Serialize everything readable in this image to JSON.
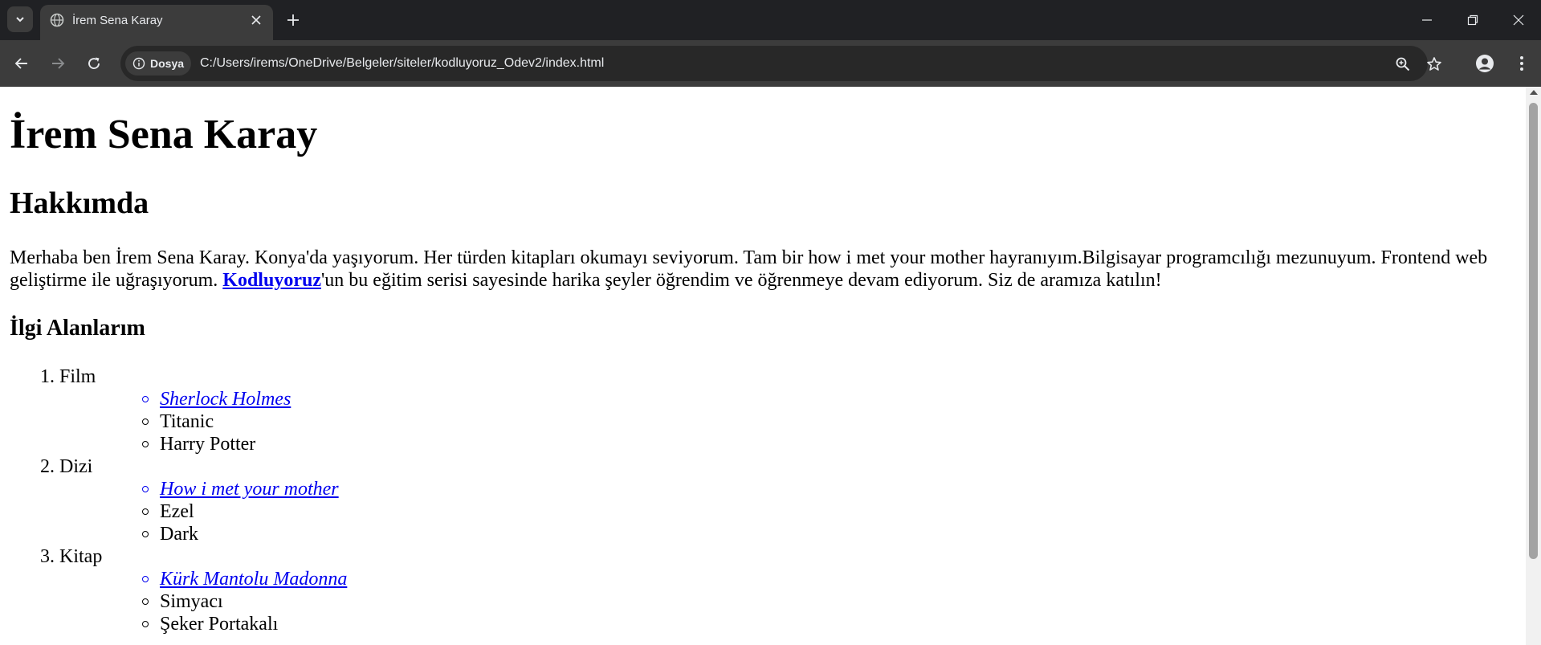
{
  "browser": {
    "tab": {
      "title": "İrem Sena Karay"
    },
    "site_chip": {
      "label": "Dosya"
    },
    "address": {
      "url": "C:/Users/irems/OneDrive/Belgeler/siteler/kodluyoruz_Odev2/index.html"
    },
    "icons": [
      "tab-search-icon",
      "globe-icon",
      "close-icon",
      "plus-icon",
      "minimize-icon",
      "restore-icon",
      "window-close-icon",
      "back-arrow-icon",
      "forward-arrow-icon",
      "reload-icon",
      "info-icon",
      "zoom-icon",
      "star-icon",
      "profile-icon",
      "kebab-menu-icon"
    ]
  },
  "page": {
    "title": "İrem Sena Karay",
    "about_heading": "Hakkımda",
    "about": {
      "before": "Merhaba ben İrem Sena Karay. Konya'da yaşıyorum. Her türden kitapları okumayı seviyorum. Tam bir how i met your mother hayranıyım.Bilgisayar programcılığı mezunuyum. Frontend web geliştirme ile uğraşıyorum. ",
      "link": "Kodluyoruz",
      "after": "'un bu eğitim serisi sayesinde harika şeyler öğrendim ve öğrenmeye devam ediyorum. Siz de aramıza katılın!"
    },
    "interests_heading": "İlgi Alanlarım",
    "categories": [
      {
        "num": "1.",
        "name": "Film",
        "items": [
          {
            "text": "Sherlock Holmes",
            "link": true
          },
          {
            "text": "Titanic",
            "link": false
          },
          {
            "text": "Harry Potter",
            "link": false
          }
        ]
      },
      {
        "num": "2.",
        "name": "Dizi",
        "items": [
          {
            "text": "How i met your mother",
            "link": true
          },
          {
            "text": "Ezel",
            "link": false
          },
          {
            "text": "Dark",
            "link": false
          }
        ]
      },
      {
        "num": "3.",
        "name": "Kitap",
        "items": [
          {
            "text": "Kürk Mantolu Madonna",
            "link": true
          },
          {
            "text": "Simyacı",
            "link": false
          },
          {
            "text": "Şeker Portakalı",
            "link": false
          }
        ]
      }
    ]
  },
  "colors": {
    "chrome_dark": "#202124",
    "toolbar": "#3c3c3c",
    "omnibox": "#282828",
    "link": "#0000ee"
  }
}
